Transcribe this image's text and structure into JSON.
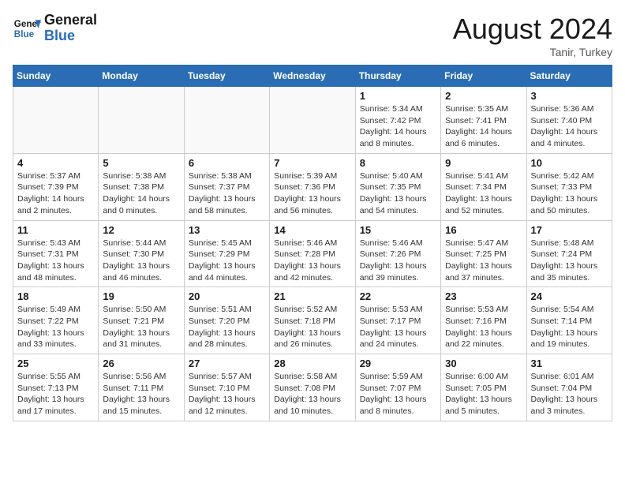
{
  "header": {
    "logo_line1": "General",
    "logo_line2": "Blue",
    "month_title": "August 2024",
    "location": "Tanir, Turkey"
  },
  "days_of_week": [
    "Sunday",
    "Monday",
    "Tuesday",
    "Wednesday",
    "Thursday",
    "Friday",
    "Saturday"
  ],
  "weeks": [
    [
      {
        "day": "",
        "info": ""
      },
      {
        "day": "",
        "info": ""
      },
      {
        "day": "",
        "info": ""
      },
      {
        "day": "",
        "info": ""
      },
      {
        "day": "1",
        "info": "Sunrise: 5:34 AM\nSunset: 7:42 PM\nDaylight: 14 hours\nand 8 minutes."
      },
      {
        "day": "2",
        "info": "Sunrise: 5:35 AM\nSunset: 7:41 PM\nDaylight: 14 hours\nand 6 minutes."
      },
      {
        "day": "3",
        "info": "Sunrise: 5:36 AM\nSunset: 7:40 PM\nDaylight: 14 hours\nand 4 minutes."
      }
    ],
    [
      {
        "day": "4",
        "info": "Sunrise: 5:37 AM\nSunset: 7:39 PM\nDaylight: 14 hours\nand 2 minutes."
      },
      {
        "day": "5",
        "info": "Sunrise: 5:38 AM\nSunset: 7:38 PM\nDaylight: 14 hours\nand 0 minutes."
      },
      {
        "day": "6",
        "info": "Sunrise: 5:38 AM\nSunset: 7:37 PM\nDaylight: 13 hours\nand 58 minutes."
      },
      {
        "day": "7",
        "info": "Sunrise: 5:39 AM\nSunset: 7:36 PM\nDaylight: 13 hours\nand 56 minutes."
      },
      {
        "day": "8",
        "info": "Sunrise: 5:40 AM\nSunset: 7:35 PM\nDaylight: 13 hours\nand 54 minutes."
      },
      {
        "day": "9",
        "info": "Sunrise: 5:41 AM\nSunset: 7:34 PM\nDaylight: 13 hours\nand 52 minutes."
      },
      {
        "day": "10",
        "info": "Sunrise: 5:42 AM\nSunset: 7:33 PM\nDaylight: 13 hours\nand 50 minutes."
      }
    ],
    [
      {
        "day": "11",
        "info": "Sunrise: 5:43 AM\nSunset: 7:31 PM\nDaylight: 13 hours\nand 48 minutes."
      },
      {
        "day": "12",
        "info": "Sunrise: 5:44 AM\nSunset: 7:30 PM\nDaylight: 13 hours\nand 46 minutes."
      },
      {
        "day": "13",
        "info": "Sunrise: 5:45 AM\nSunset: 7:29 PM\nDaylight: 13 hours\nand 44 minutes."
      },
      {
        "day": "14",
        "info": "Sunrise: 5:46 AM\nSunset: 7:28 PM\nDaylight: 13 hours\nand 42 minutes."
      },
      {
        "day": "15",
        "info": "Sunrise: 5:46 AM\nSunset: 7:26 PM\nDaylight: 13 hours\nand 39 minutes."
      },
      {
        "day": "16",
        "info": "Sunrise: 5:47 AM\nSunset: 7:25 PM\nDaylight: 13 hours\nand 37 minutes."
      },
      {
        "day": "17",
        "info": "Sunrise: 5:48 AM\nSunset: 7:24 PM\nDaylight: 13 hours\nand 35 minutes."
      }
    ],
    [
      {
        "day": "18",
        "info": "Sunrise: 5:49 AM\nSunset: 7:22 PM\nDaylight: 13 hours\nand 33 minutes."
      },
      {
        "day": "19",
        "info": "Sunrise: 5:50 AM\nSunset: 7:21 PM\nDaylight: 13 hours\nand 31 minutes."
      },
      {
        "day": "20",
        "info": "Sunrise: 5:51 AM\nSunset: 7:20 PM\nDaylight: 13 hours\nand 28 minutes."
      },
      {
        "day": "21",
        "info": "Sunrise: 5:52 AM\nSunset: 7:18 PM\nDaylight: 13 hours\nand 26 minutes."
      },
      {
        "day": "22",
        "info": "Sunrise: 5:53 AM\nSunset: 7:17 PM\nDaylight: 13 hours\nand 24 minutes."
      },
      {
        "day": "23",
        "info": "Sunrise: 5:53 AM\nSunset: 7:16 PM\nDaylight: 13 hours\nand 22 minutes."
      },
      {
        "day": "24",
        "info": "Sunrise: 5:54 AM\nSunset: 7:14 PM\nDaylight: 13 hours\nand 19 minutes."
      }
    ],
    [
      {
        "day": "25",
        "info": "Sunrise: 5:55 AM\nSunset: 7:13 PM\nDaylight: 13 hours\nand 17 minutes."
      },
      {
        "day": "26",
        "info": "Sunrise: 5:56 AM\nSunset: 7:11 PM\nDaylight: 13 hours\nand 15 minutes."
      },
      {
        "day": "27",
        "info": "Sunrise: 5:57 AM\nSunset: 7:10 PM\nDaylight: 13 hours\nand 12 minutes."
      },
      {
        "day": "28",
        "info": "Sunrise: 5:58 AM\nSunset: 7:08 PM\nDaylight: 13 hours\nand 10 minutes."
      },
      {
        "day": "29",
        "info": "Sunrise: 5:59 AM\nSunset: 7:07 PM\nDaylight: 13 hours\nand 8 minutes."
      },
      {
        "day": "30",
        "info": "Sunrise: 6:00 AM\nSunset: 7:05 PM\nDaylight: 13 hours\nand 5 minutes."
      },
      {
        "day": "31",
        "info": "Sunrise: 6:01 AM\nSunset: 7:04 PM\nDaylight: 13 hours\nand 3 minutes."
      }
    ]
  ]
}
